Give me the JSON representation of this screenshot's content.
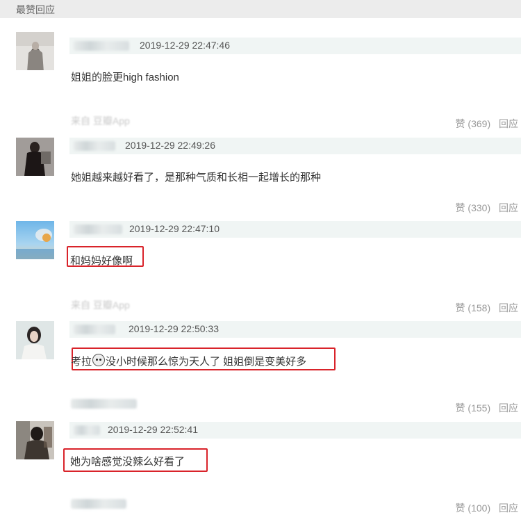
{
  "header": {
    "title": "最赞回应"
  },
  "comments": [
    {
      "timestamp": "2019-12-29 22:47:46",
      "text": "姐姐的脸更high fashion",
      "source": "",
      "likes": "赞 (369)",
      "reply": "回应"
    },
    {
      "timestamp": "2019-12-29 22:49:26",
      "text": "她姐越来越好看了，是那种气质和长相一起增长的那种",
      "source": "来自 豆瓣App",
      "likes": "赞 (330)",
      "reply": "回应"
    },
    {
      "timestamp": "2019-12-29 22:47:10",
      "text": "和妈妈好像啊",
      "source": "",
      "likes": "赞 (158)",
      "reply": "回应"
    },
    {
      "timestamp": "2019-12-29 22:50:33",
      "text_pre": "考拉",
      "text_post": "没小时候那么惊为天人了 姐姐倒是变美好多",
      "source": "来自 豆瓣App",
      "likes": "赞 (155)",
      "reply": "回应"
    },
    {
      "timestamp": "2019-12-29 22:52:41",
      "text": "她为啥感觉没辣么好看了",
      "source": "",
      "likes": "赞 (100)",
      "reply": "回应"
    }
  ],
  "colors": {
    "highlight": "#d9232a",
    "meta_bar": "#f0f5f4",
    "header_bg": "#ececec"
  }
}
